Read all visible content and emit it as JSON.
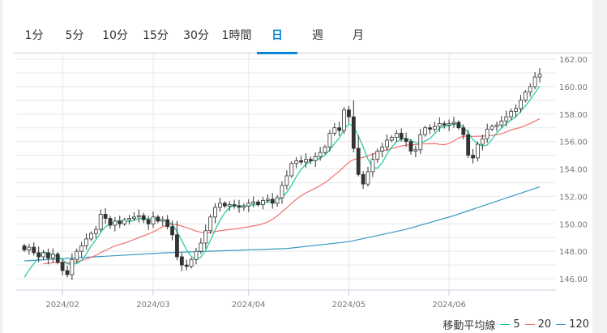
{
  "tabs": [
    {
      "label": "1分"
    },
    {
      "label": "5分"
    },
    {
      "label": "10分"
    },
    {
      "label": "15分"
    },
    {
      "label": "30分"
    },
    {
      "label": "1時間"
    },
    {
      "label": "日",
      "active": true
    },
    {
      "label": "週"
    },
    {
      "label": "月"
    }
  ],
  "colors": {
    "accent": "#0a84d6",
    "ma5": "#19c8a0",
    "ma20": "#f07070",
    "ma120": "#3a9ac0",
    "candle": "#333333"
  },
  "legend": {
    "title": "移動平均線",
    "items": [
      {
        "label": "5",
        "color": "#19c8a0"
      },
      {
        "label": "20",
        "color": "#f07070"
      },
      {
        "label": "120",
        "color": "#3a9ac0"
      }
    ]
  },
  "chart_data": {
    "type": "candlestick",
    "ylim": [
      145.2,
      162.4
    ],
    "yticks": [
      "146.00",
      "148.00",
      "150.00",
      "152.00",
      "154.00",
      "156.00",
      "158.00",
      "160.00",
      "162.00"
    ],
    "xticks": [
      {
        "label": "2024/02",
        "index": 8
      },
      {
        "label": "2024/03",
        "index": 27
      },
      {
        "label": "2024/04",
        "index": 47
      },
      {
        "label": "2024/05",
        "index": 68
      },
      {
        "label": "2024/06",
        "index": 89
      }
    ],
    "close": [
      148.1,
      148.3,
      147.9,
      147.6,
      147.9,
      147.5,
      147.8,
      147.2,
      146.6,
      146.3,
      147.4,
      148.0,
      148.4,
      148.9,
      149.3,
      149.6,
      150.7,
      150.4,
      149.9,
      150.2,
      150.0,
      150.3,
      150.4,
      150.5,
      150.6,
      150.3,
      150.0,
      150.5,
      150.2,
      150.3,
      149.8,
      149.2,
      147.6,
      147.0,
      146.9,
      147.4,
      148.0,
      148.6,
      149.5,
      150.5,
      151.2,
      151.5,
      151.3,
      151.4,
      151.3,
      151.2,
      151.3,
      151.5,
      151.6,
      151.4,
      151.7,
      151.8,
      151.5,
      151.9,
      152.8,
      153.5,
      154.4,
      154.6,
      154.5,
      154.7,
      154.6,
      154.9,
      155.2,
      155.6,
      156.6,
      157.0,
      156.8,
      158.3,
      157.8,
      155.5,
      153.6,
      152.9,
      153.8,
      154.7,
      155.3,
      155.6,
      156.1,
      156.3,
      156.6,
      156.2,
      156.0,
      155.3,
      155.4,
      156.5,
      157.0,
      156.9,
      157.1,
      157.3,
      157.2,
      157.3,
      157.4,
      157.0,
      156.5,
      155.0,
      154.8,
      155.8,
      156.2,
      156.9,
      157.1,
      157.2,
      157.5,
      157.8,
      158.2,
      158.4,
      159.0,
      159.6,
      160.0,
      160.7,
      160.9
    ],
    "ma120": [
      [
        0,
        147.3
      ],
      [
        30,
        147.9
      ],
      [
        55,
        148.2
      ],
      [
        68,
        148.7
      ],
      [
        80,
        149.6
      ],
      [
        90,
        150.6
      ],
      [
        108,
        152.7
      ]
    ]
  }
}
